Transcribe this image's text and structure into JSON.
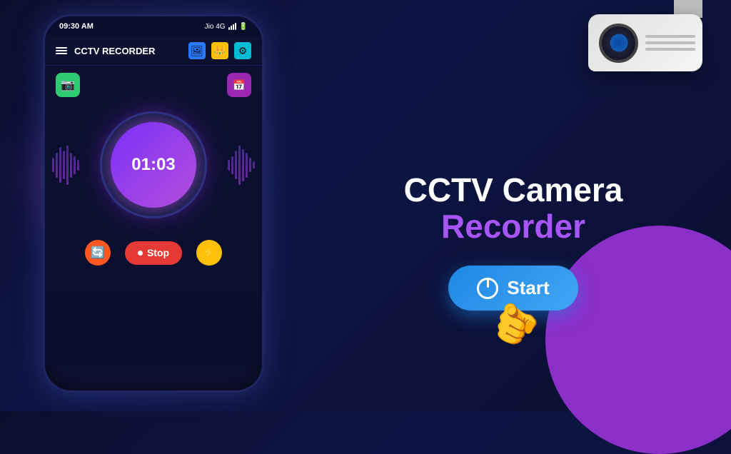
{
  "app": {
    "title": "CCTV RECORDER",
    "status_time": "09:30 AM",
    "status_carrier": "Jio 4G",
    "timer": "01:03",
    "heading_line1": "CCTV Camera",
    "heading_line2": "Recorder",
    "start_label": "Start",
    "stop_label": "Stop",
    "nav": {
      "hamburger": "☰",
      "icon1": "🖼",
      "icon2": "👑",
      "icon3": "⚙"
    },
    "bottom_buttons": {
      "refresh": "🔄",
      "stop_icon": "⏺",
      "flash": "⚡"
    }
  }
}
